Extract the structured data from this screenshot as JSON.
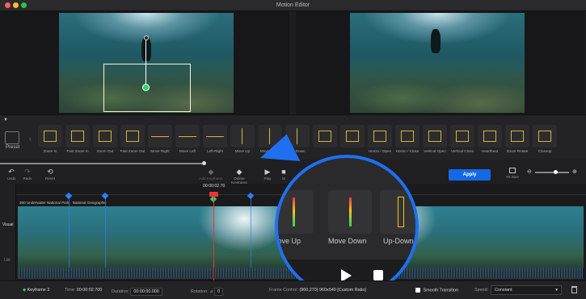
{
  "window": {
    "title": "Motion Editor"
  },
  "presets": {
    "collapse_icon": "triangle-down",
    "label": "Preset",
    "items": [
      {
        "label": "Zoom In",
        "glyph": "box"
      },
      {
        "label": "Fast Zoom In",
        "glyph": "box"
      },
      {
        "label": "Zoom Out",
        "glyph": "box"
      },
      {
        "label": "Fast Zoom Out",
        "glyph": "box"
      },
      {
        "label": "Move Right",
        "glyph": "hline"
      },
      {
        "label": "Move Left",
        "glyph": "hline"
      },
      {
        "label": "Left-Right",
        "glyph": "hline"
      },
      {
        "label": "Move Up",
        "glyph": "line"
      },
      {
        "label": "Move Down",
        "glyph": "line"
      },
      {
        "label": "Up-Down",
        "glyph": "line"
      },
      {
        "label": "",
        "glyph": "box"
      },
      {
        "label": "",
        "glyph": "box"
      },
      {
        "label": "Horizo / Open",
        "glyph": "box"
      },
      {
        "label": "Horizo / Close",
        "glyph": "box"
      },
      {
        "label": "Vertical Open",
        "glyph": "box"
      },
      {
        "label": "Vertical Close",
        "glyph": "box"
      },
      {
        "label": "Heartbeat",
        "glyph": "box"
      },
      {
        "label": "Zoom Rotate",
        "glyph": "box"
      },
      {
        "label": "Closeup",
        "glyph": "box"
      }
    ]
  },
  "toolbar": {
    "undo": "Undo",
    "redo": "Redo",
    "reset": "Reset",
    "add_keyframe": "Add Keyframe",
    "delete_keyframe": "Delete Keyframe",
    "play": "Play",
    "stop": "St",
    "apply": "Apply",
    "fit_size": "Fit Size"
  },
  "timeline": {
    "side_visual": "Visual",
    "side_list": "List",
    "timecode": "00:00:02.70",
    "track_name": "360 Underwater National Park · National Geographic"
  },
  "magnifier": {
    "labels": [
      "Move Up",
      "Move Down",
      "Up-Down"
    ]
  },
  "status": {
    "keyframe": "Keyframe 3",
    "time_label": "Time:",
    "time_value": "00:00:02.700",
    "duration_label": "Duration:",
    "duration_value": "00:00:00.000",
    "rotation_label": "Rotation:",
    "rotation_value": "0",
    "frame_label": "Frame Control:",
    "frame_value": "(960,270)  960x540  [Custom Ratio]",
    "smooth_label": "Smooth Transition",
    "speed_label": "Speed:",
    "speed_value": "Constant"
  },
  "colors": {
    "accent": "#1468e6",
    "keyframe_blue": "#2f7df6",
    "keyframe_green": "#2bd36b",
    "playhead": "#ee3333",
    "preset_glyph": "#d9b23b"
  }
}
